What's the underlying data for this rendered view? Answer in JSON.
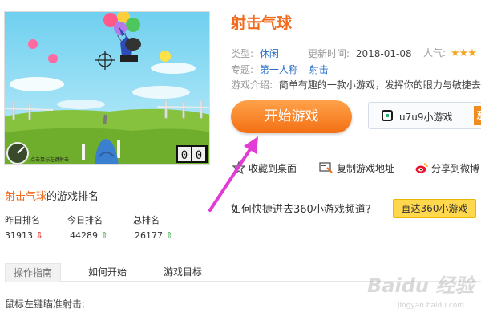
{
  "game": {
    "title": "射击气球",
    "type_label": "类型:",
    "type_value": "休闲",
    "updated_label": "更新时间:",
    "updated_value": "2018-01-08",
    "popularity_label": "人气:",
    "topic_label": "专题:",
    "topics": [
      "第一人称",
      "射击"
    ],
    "intro_label": "游戏介绍:",
    "intro_text": "简单有趣的一款小游戏，发挥你的眼力与敏捷去帮",
    "thumbnail_caption": "点击鼠标左键射击",
    "thumbnail_score": "00"
  },
  "actions": {
    "start_button": "开始游戏",
    "mobile_label": "u7u9小游戏",
    "mobile_tag": "系",
    "bookmark": "收藏到桌面",
    "copy_address": "复制游戏地址",
    "share_weibo": "分享到微博"
  },
  "channel": {
    "question": "如何快捷进去360小游戏频道?",
    "button": "直达360小游戏"
  },
  "ranking": {
    "title_highlight": "射击气球",
    "title_rest": "的游戏排名",
    "items": [
      {
        "label": "昨日排名",
        "value": "31913",
        "trend": "down"
      },
      {
        "label": "今日排名",
        "value": "44289",
        "trend": "up"
      },
      {
        "label": "总排名",
        "value": "26177",
        "trend": "up"
      }
    ]
  },
  "tabs": [
    "操作指南",
    "如何开始",
    "游戏目标"
  ],
  "guide_text": "鼠标左键瞄准射击;",
  "watermark": {
    "brand": "Baidu 经验",
    "url": "jingyan.baidu.com"
  },
  "colors": {
    "accent": "#f26b1d",
    "link": "#2a6fc9",
    "annotation_arrow": "#e23bd6"
  }
}
